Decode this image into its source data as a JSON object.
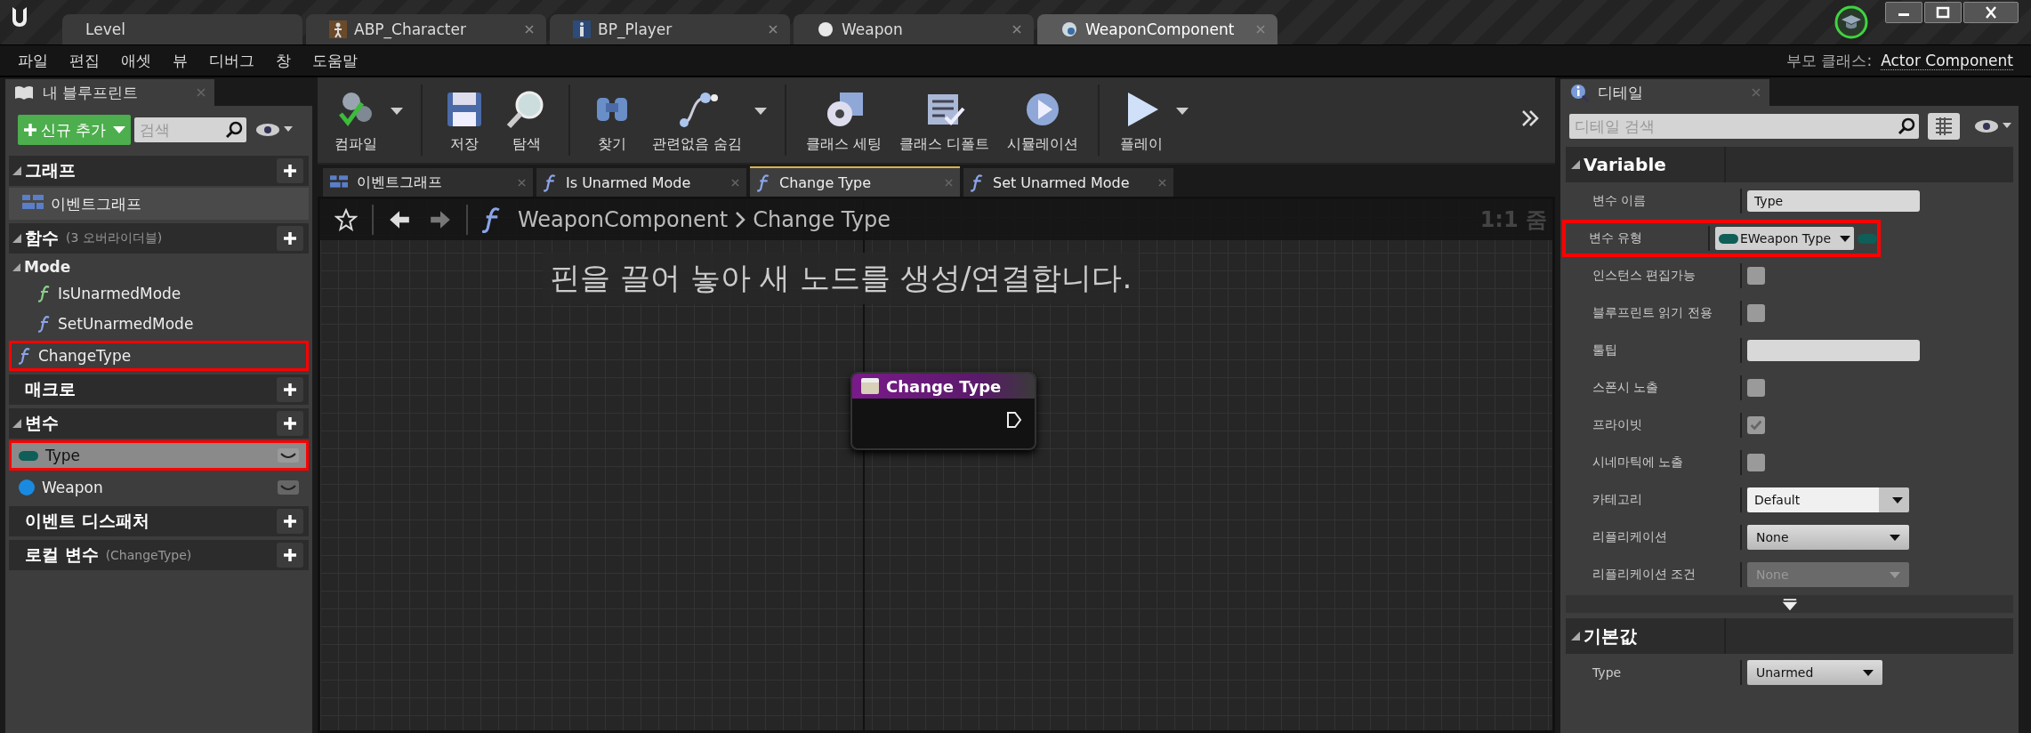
{
  "window": {
    "tabs": [
      {
        "label": "Level",
        "kind": "level",
        "selected": false,
        "closable": false
      },
      {
        "label": "ABP_Character",
        "kind": "anim",
        "selected": false,
        "closable": true
      },
      {
        "label": "BP_Player",
        "kind": "blueprint",
        "selected": false,
        "closable": true
      },
      {
        "label": "Weapon",
        "kind": "sphere",
        "selected": false,
        "closable": true
      },
      {
        "label": "WeaponComponent",
        "kind": "component",
        "selected": true,
        "closable": true
      }
    ]
  },
  "menu": [
    "파일",
    "편집",
    "애셋",
    "뷰",
    "디버그",
    "창",
    "도움말"
  ],
  "parent_class": {
    "label": "부모 클래스:",
    "value": "Actor Component"
  },
  "my_blueprint": {
    "tab": "내 블루프린트",
    "add_button": "신규 추가",
    "search_placeholder": "검색",
    "sections": [
      {
        "title": "그래프",
        "expanded": true,
        "items": [
          {
            "label": "이벤트그래프",
            "kind": "graph",
            "selected": false
          }
        ]
      },
      {
        "title": "함수",
        "note": "(3 오버라이더블)",
        "expanded": true,
        "items": [
          {
            "label": "Mode",
            "kind": "category",
            "children": [
              {
                "label": "IsUnarmedMode",
                "kind": "pure-function",
                "selected": false
              },
              {
                "label": "SetUnarmedMode",
                "kind": "function",
                "selected": false
              }
            ]
          },
          {
            "label": "ChangeType",
            "kind": "function",
            "selected": false,
            "highlighted": true
          }
        ]
      },
      {
        "title": "매크로"
      },
      {
        "title": "변수",
        "expanded": true,
        "items": [
          {
            "label": "Type",
            "kind": "variable",
            "color": "#0f5e58",
            "selected": true,
            "highlighted": true
          },
          {
            "label": "Weapon",
            "kind": "object-variable",
            "color": "#1a8ae0",
            "selected": false
          }
        ]
      },
      {
        "title": "이벤트 디스패처"
      },
      {
        "title": "로컬 변수",
        "note": "(ChangeType)"
      }
    ]
  },
  "toolbar": {
    "groups": [
      [
        {
          "label": "컴파일",
          "kind": "compile",
          "dropdown": true
        }
      ],
      [
        {
          "label": "저장",
          "kind": "save"
        },
        {
          "label": "탐색",
          "kind": "browse"
        }
      ],
      [
        {
          "label": "찾기",
          "kind": "find"
        },
        {
          "label": "관련없음 숨김",
          "kind": "hide",
          "dropdown": true
        }
      ],
      [
        {
          "label": "클래스 세팅",
          "kind": "class-settings"
        },
        {
          "label": "클래스 디폴트",
          "kind": "class-defaults"
        },
        {
          "label": "시뮬레이션",
          "kind": "simulate"
        }
      ],
      [
        {
          "label": "플레이",
          "kind": "play",
          "dropdown": true
        }
      ]
    ]
  },
  "graph_tabs": [
    {
      "label": "이벤트그래프",
      "kind": "graph",
      "selected": false
    },
    {
      "label": "Is Unarmed Mode",
      "kind": "function",
      "selected": false
    },
    {
      "label": "Change Type",
      "kind": "function",
      "selected": true
    },
    {
      "label": "Set Unarmed Mode",
      "kind": "function",
      "selected": false
    }
  ],
  "breadcrumb": [
    "WeaponComponent",
    "Change Type"
  ],
  "zoom_label": "1:1 줌",
  "graph_hint": "핀을 끌어 놓아 새 노드를 생성/연결합니다.",
  "node": {
    "title": "Change Type"
  },
  "details": {
    "tab": "디테일",
    "search_placeholder": "디테일 검색",
    "sections": [
      {
        "title": "Variable",
        "expanded": true,
        "rows": [
          {
            "label": "변수 이름",
            "kind": "text",
            "value": "Type"
          },
          {
            "label": "변수 유형",
            "kind": "type",
            "value": "EWeapon Type",
            "color": "#0f5e58",
            "highlighted": true
          },
          {
            "label": "인스턴스 편집가능",
            "kind": "checkbox",
            "checked": false
          },
          {
            "label": "블루프린트 읽기 전용",
            "kind": "checkbox",
            "checked": false
          },
          {
            "label": "툴팁",
            "kind": "text"
          },
          {
            "label": "스폰시 노출",
            "kind": "checkbox",
            "checked": false
          },
          {
            "label": "프라이빗",
            "kind": "checkbox",
            "checked": true
          },
          {
            "label": "시네마틱에 노출",
            "kind": "checkbox",
            "checked": false
          },
          {
            "label": "카테고리",
            "kind": "combo",
            "value": "Default"
          },
          {
            "label": "리플리케이션",
            "kind": "dropdown",
            "value": "None",
            "disabled": false
          },
          {
            "label": "리플리케이션 조건",
            "kind": "dropdown",
            "value": "None",
            "disabled": true
          }
        ],
        "advanced": true
      },
      {
        "title": "기본값",
        "expanded": true,
        "rows": [
          {
            "label": "Type",
            "kind": "dropdown",
            "value": "Unarmed",
            "disabled": false
          }
        ]
      }
    ]
  }
}
